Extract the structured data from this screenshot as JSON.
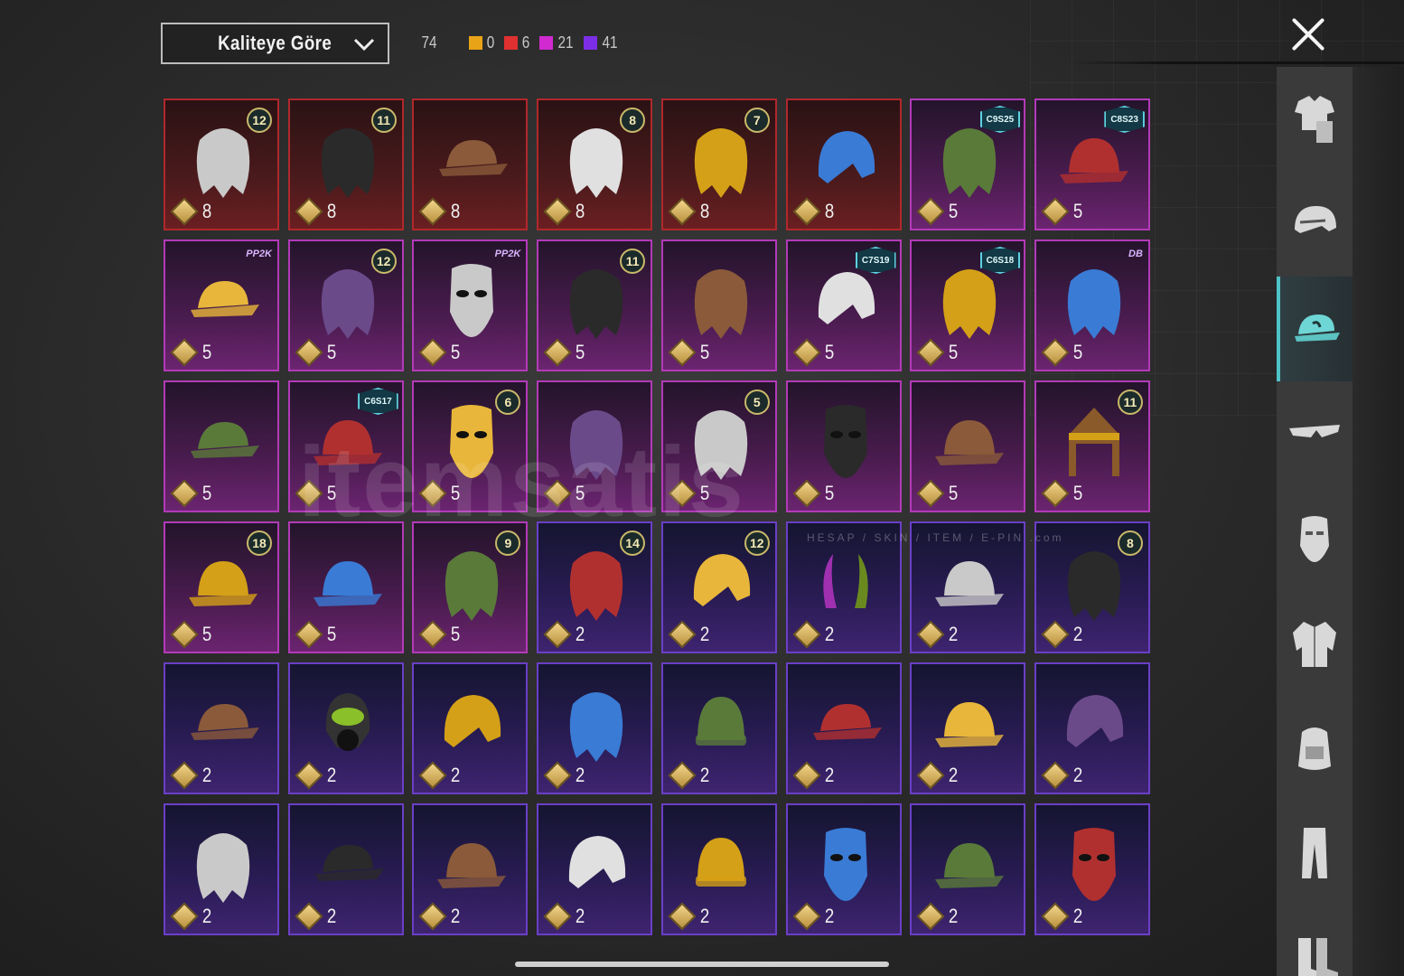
{
  "filter": {
    "sort_label": "Kaliteye Göre"
  },
  "summary": {
    "total": "74",
    "qualities": [
      {
        "color": "#e8a317",
        "count": "0"
      },
      {
        "color": "#e03030",
        "count": "6"
      },
      {
        "color": "#d02ad0",
        "count": "21"
      },
      {
        "color": "#7b2ee6",
        "count": "41"
      }
    ]
  },
  "categories": [
    {
      "name": "outfit-icon",
      "active": false
    },
    {
      "name": "helmet-icon",
      "active": false
    },
    {
      "name": "hat-icon",
      "active": true
    },
    {
      "name": "glasses-icon",
      "active": false
    },
    {
      "name": "mask-icon",
      "active": false
    },
    {
      "name": "jacket-icon",
      "active": false
    },
    {
      "name": "backpack-icon",
      "active": false
    },
    {
      "name": "pants-icon",
      "active": false
    },
    {
      "name": "shoes-icon",
      "active": false
    }
  ],
  "items": [
    {
      "q": "red",
      "count": "8",
      "badge": "12",
      "type": "badge",
      "art": "hair-icon"
    },
    {
      "q": "red",
      "count": "8",
      "badge": "11",
      "type": "badge",
      "art": "hair-icon"
    },
    {
      "q": "red",
      "count": "8",
      "badge": "",
      "type": "",
      "art": "cowboy-hat-icon"
    },
    {
      "q": "red",
      "count": "8",
      "badge": "8",
      "type": "badge",
      "art": "hair-icon"
    },
    {
      "q": "red",
      "count": "8",
      "badge": "7",
      "type": "badge",
      "art": "hair-icon"
    },
    {
      "q": "red",
      "count": "8",
      "badge": "",
      "type": "",
      "art": "helmet-icon"
    },
    {
      "q": "pink",
      "count": "5",
      "badge": "C9S25",
      "type": "season",
      "art": "hair-icon"
    },
    {
      "q": "pink",
      "count": "5",
      "badge": "C8S23",
      "type": "season",
      "art": "headphones-icon"
    },
    {
      "q": "pink",
      "count": "5",
      "badge": "PP2K",
      "type": "logo",
      "art": "cap-icon"
    },
    {
      "q": "pink",
      "count": "5",
      "badge": "12",
      "type": "badge",
      "art": "hair-icon"
    },
    {
      "q": "pink",
      "count": "5",
      "badge": "PP2K",
      "type": "logo",
      "art": "mask-icon"
    },
    {
      "q": "pink",
      "count": "5",
      "badge": "11",
      "type": "badge",
      "art": "hair-icon"
    },
    {
      "q": "pink",
      "count": "5",
      "badge": "",
      "type": "",
      "art": "hair-icon"
    },
    {
      "q": "pink",
      "count": "5",
      "badge": "C7S19",
      "type": "season",
      "art": "helmet-icon"
    },
    {
      "q": "pink",
      "count": "5",
      "badge": "C6S18",
      "type": "season",
      "art": "hair-icon"
    },
    {
      "q": "pink",
      "count": "5",
      "badge": "DB",
      "type": "logo",
      "art": "hair-icon"
    },
    {
      "q": "pink",
      "count": "5",
      "badge": "",
      "type": "",
      "art": "cap-icon"
    },
    {
      "q": "pink",
      "count": "5",
      "badge": "C6S17",
      "type": "season",
      "art": "visor-icon"
    },
    {
      "q": "pink",
      "count": "5",
      "badge": "6",
      "type": "badge",
      "art": "mask-icon"
    },
    {
      "q": "pink",
      "count": "5",
      "badge": "",
      "type": "",
      "art": "hair-icon"
    },
    {
      "q": "pink",
      "count": "5",
      "badge": "5",
      "type": "badge",
      "art": "hair-icon"
    },
    {
      "q": "pink",
      "count": "5",
      "badge": "",
      "type": "",
      "art": "mask-icon"
    },
    {
      "q": "pink",
      "count": "5",
      "badge": "",
      "type": "",
      "art": "bucket-hat-icon"
    },
    {
      "q": "pink",
      "count": "5",
      "badge": "11",
      "type": "badge",
      "art": "crown-icon"
    },
    {
      "q": "pink",
      "count": "5",
      "badge": "18",
      "type": "badge",
      "art": "hat-icon"
    },
    {
      "q": "pink",
      "count": "5",
      "badge": "",
      "type": "",
      "art": "feather-icon"
    },
    {
      "q": "pink",
      "count": "5",
      "badge": "9",
      "type": "badge",
      "art": "hair-icon"
    },
    {
      "q": "purple",
      "count": "2",
      "badge": "14",
      "type": "badge",
      "art": "hair-icon"
    },
    {
      "q": "purple",
      "count": "2",
      "badge": "12",
      "type": "badge",
      "art": "helmet-icon"
    },
    {
      "q": "purple",
      "count": "2",
      "badge": "",
      "type": "",
      "art": "horns-icon"
    },
    {
      "q": "purple",
      "count": "2",
      "badge": "",
      "type": "",
      "art": "officer-cap-icon"
    },
    {
      "q": "purple",
      "count": "2",
      "badge": "8",
      "type": "badge",
      "art": "hair-icon"
    },
    {
      "q": "purple",
      "count": "2",
      "badge": "",
      "type": "",
      "art": "cap-icon"
    },
    {
      "q": "purple",
      "count": "2",
      "badge": "",
      "type": "",
      "art": "gasmask-icon"
    },
    {
      "q": "purple",
      "count": "2",
      "badge": "",
      "type": "",
      "art": "helmet-icon"
    },
    {
      "q": "purple",
      "count": "2",
      "badge": "",
      "type": "",
      "art": "hair-icon"
    },
    {
      "q": "purple",
      "count": "2",
      "badge": "",
      "type": "",
      "art": "beanie-icon"
    },
    {
      "q": "purple",
      "count": "2",
      "badge": "",
      "type": "",
      "art": "cap-icon"
    },
    {
      "q": "purple",
      "count": "2",
      "badge": "",
      "type": "",
      "art": "hat-icon"
    },
    {
      "q": "purple",
      "count": "2",
      "badge": "",
      "type": "",
      "art": "helmet-icon"
    },
    {
      "q": "purple",
      "count": "2",
      "badge": "",
      "type": "",
      "art": "hair-icon"
    },
    {
      "q": "purple",
      "count": "2",
      "badge": "",
      "type": "",
      "art": "cap-icon"
    },
    {
      "q": "purple",
      "count": "2",
      "badge": "",
      "type": "",
      "art": "fedora-icon"
    },
    {
      "q": "purple",
      "count": "2",
      "badge": "",
      "type": "",
      "art": "helmet-icon"
    },
    {
      "q": "purple",
      "count": "2",
      "badge": "",
      "type": "",
      "art": "beanie-icon"
    },
    {
      "q": "purple",
      "count": "2",
      "badge": "",
      "type": "",
      "art": "mask-icon"
    },
    {
      "q": "purple",
      "count": "2",
      "badge": "",
      "type": "",
      "art": "bucket-hat-icon"
    },
    {
      "q": "purple",
      "count": "2",
      "badge": "",
      "type": "",
      "art": "balaclava-icon"
    }
  ],
  "watermark": {
    "brand": "itemsatis",
    "tagline": "HESAP / SKIN / ITEM / E-PIN",
    "domain": ".com"
  }
}
